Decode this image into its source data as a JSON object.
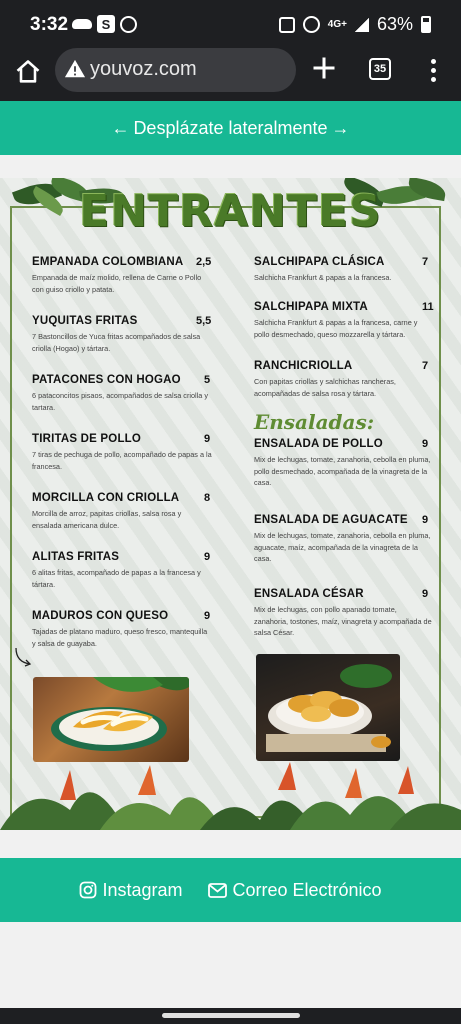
{
  "status_bar": {
    "time": "3:32",
    "network": "4G+",
    "battery": "63%",
    "left_icons": [
      "cloud-icon",
      "s-app-icon",
      "whatsapp-icon"
    ],
    "right_icons": [
      "battery-saver-icon",
      "alarm-icon",
      "data-icon",
      "signal-icon",
      "battery-icon"
    ]
  },
  "browser": {
    "url": "youvoz.com",
    "tab_count": "35",
    "icons": [
      "home-icon",
      "warning-icon",
      "plus-icon",
      "tabs-icon",
      "menu-icon"
    ]
  },
  "banner": {
    "text": "Desplázate lateralmente",
    "arrow_left": "←",
    "arrow_right": "→"
  },
  "menu": {
    "title": "ENTRANTES",
    "left_items": [
      {
        "name": "EMPANADA COLOMBIANA",
        "price": "2,5",
        "desc": "Empanada de maíz molido, rellena de Carne o Pollo con guiso criollo y patata."
      },
      {
        "name": "YUQUITAS FRITAS",
        "price": "5,5",
        "desc": "7 Bastoncillos de Yuca fritas acompañados de salsa criolla (Hogao) y tártara."
      },
      {
        "name": "PATACONES CON HOGAO",
        "price": "5",
        "desc": "6 pataconcitos pisaos,  acompañados de salsa criolla y tartara."
      },
      {
        "name": "TIRITAS DE POLLO",
        "price": "9",
        "desc": "7 tiras de pechuga de pollo,  acompañado de papas a la francesa."
      },
      {
        "name": "MORCILLA CON CRIOLLA",
        "price": "8",
        "desc": "Morcilla de arroz,  papitas criollas, salsa rosa y ensalada americana dulce."
      },
      {
        "name": "ALITAS FRITAS",
        "price": "9",
        "desc": "6 alitas fritas, acompañado de papas a la francesa y tártara."
      },
      {
        "name": "MADUROS CON QUESO",
        "price": "9",
        "desc": "Tajadas de platano maduro, queso fresco, mantequilla y salsa de guayaba."
      }
    ],
    "right_items": [
      {
        "name": "SALCHIPAPA CLÁSICA",
        "price": "7",
        "desc": "Salchicha Frankfurt & papas a la francesa."
      },
      {
        "name": "SALCHIPAPA MIXTA",
        "price": "11",
        "desc": "Salchicha Frankfurt & papas a la francesa, carne y pollo desmechado, queso mozzarella y tártara."
      },
      {
        "name": "RANCHICRIOLLA",
        "price": "7",
        "desc": "Con papitas criollas y salchichas rancheras, acompañadas de  salsa rosa y tártara."
      }
    ],
    "salads_heading": "Ensaladas:",
    "salad_items": [
      {
        "name": "ENSALADA DE POLLO",
        "price": "9",
        "desc": "Mix de lechugas, tomate, zanahoria, cebolla en pluma, pollo desmechado, acompañada de la vinagreta de la casa."
      },
      {
        "name": "ENSALADA DE AGUACATE",
        "price": "9",
        "desc": "Mix de lechugas, tomate, zanahoria, cebolla en pluma, aguacate, maíz, acompañada de la vinagreta de la casa."
      },
      {
        "name": "ENSALADA CÉSAR",
        "price": "9",
        "desc": "Mix de lechugas, con pollo apanado tomate, zanahoria,  tostones, maíz, vinagreta y acompañada de salsa César."
      }
    ]
  },
  "footer": {
    "instagram": "Instagram",
    "email": "Correo Electrónico"
  },
  "colors": {
    "accent": "#17b894",
    "title_green": "#4a7a28",
    "chrome_dark": "#1e1f22"
  }
}
